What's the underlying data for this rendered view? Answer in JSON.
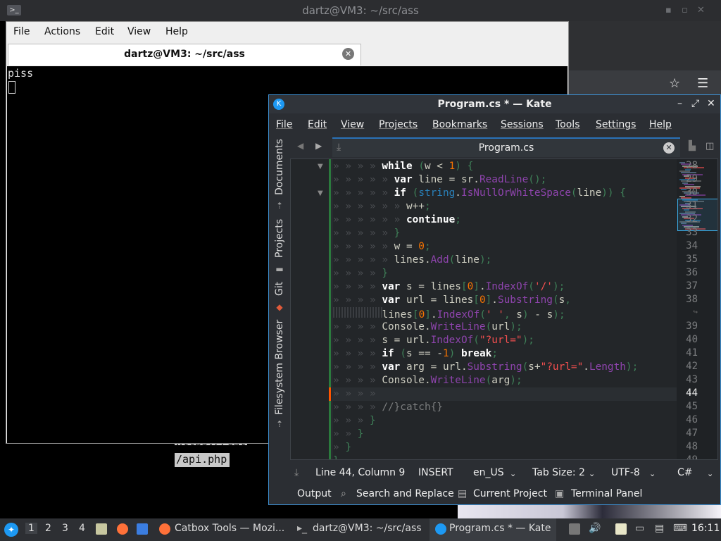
{
  "desktop": {
    "top_bar_title": "dartz@VM3: ~/src/ass",
    "bg_url_fragment": "https://cat",
    "bg_url_path": "/api.php"
  },
  "terminal": {
    "menu": [
      "File",
      "Actions",
      "Edit",
      "View",
      "Help"
    ],
    "tab_title": "dartz@VM3: ~/src/ass",
    "output_line": "piss"
  },
  "kate": {
    "window_title": "Program.cs * — Kate",
    "menu": [
      "File",
      "Edit",
      "View",
      "Projects",
      "Bookmarks",
      "Sessions",
      "Tools",
      "Settings",
      "Help"
    ],
    "sidebar_tabs": [
      "Documents",
      "Projects",
      "Git",
      "Filesystem Browser"
    ],
    "doc_tab_title": "Program.cs",
    "code_lines": [
      {
        "n": "28",
        "indent": 4,
        "code": "while (w < 1) {"
      },
      {
        "n": "29",
        "indent": 5,
        "code": "var line = sr.ReadLine();"
      },
      {
        "n": "30",
        "indent": 5,
        "code": "if (string.IsNullOrWhiteSpace(line)) {"
      },
      {
        "n": "31",
        "indent": 6,
        "code": "w++;"
      },
      {
        "n": "32",
        "indent": 6,
        "code": "continue;"
      },
      {
        "n": "33",
        "indent": 5,
        "code": "}"
      },
      {
        "n": "34",
        "indent": 5,
        "code": "w = 0;"
      },
      {
        "n": "35",
        "indent": 5,
        "code": "lines.Add(line);"
      },
      {
        "n": "36",
        "indent": 4,
        "code": "}"
      },
      {
        "n": "37",
        "indent": 4,
        "code": "var s = lines[0].IndexOf('/');"
      },
      {
        "n": "38",
        "indent": 4,
        "code": "var url = lines[0].Substring(s,"
      },
      {
        "n": "",
        "indent": 4,
        "code": "lines[0].IndexOf(' ', s) - s);"
      },
      {
        "n": "39",
        "indent": 4,
        "code": "Console.WriteLine(url);"
      },
      {
        "n": "40",
        "indent": 4,
        "code": "s = url.IndexOf(\"?url=\");"
      },
      {
        "n": "41",
        "indent": 4,
        "code": "if (s == -1) break;"
      },
      {
        "n": "42",
        "indent": 4,
        "code": "var arg = url.Substring(s+\"?url=\".Length);"
      },
      {
        "n": "43",
        "indent": 4,
        "code": "Console.WriteLine(arg);"
      },
      {
        "n": "44",
        "indent": 4,
        "code": ""
      },
      {
        "n": "45",
        "indent": 4,
        "code": "//}catch{}"
      },
      {
        "n": "46",
        "indent": 3,
        "code": "}"
      },
      {
        "n": "47",
        "indent": 2,
        "code": "}"
      },
      {
        "n": "48",
        "indent": 1,
        "code": "}"
      },
      {
        "n": "49",
        "indent": 0,
        "code": "}"
      }
    ],
    "current_line": "44",
    "status": {
      "position": "Line 44, Column 9",
      "mode": "INSERT",
      "dictionary": "en_US",
      "tab_size": "Tab Size: 2",
      "encoding": "UTF-8",
      "language": "C#"
    },
    "tool_panels": [
      "Output",
      "Search and Replace",
      "Current Project",
      "Terminal Panel"
    ]
  },
  "taskbar": {
    "workspaces": [
      "1",
      "2",
      "3",
      "4"
    ],
    "active_workspace": "1",
    "windows": [
      "Catbox Tools — Mozi...",
      "dartz@VM3: ~/src/ass",
      "Program.cs * — Kate"
    ],
    "clock": "16:11"
  },
  "colors": {
    "kate_bg": "#232629",
    "kate_accent": "#3daee9",
    "keyword": "#ffffff",
    "method": "#8e44ad",
    "type": "#2980b9",
    "number": "#f67400",
    "string": "#f44f4f"
  }
}
